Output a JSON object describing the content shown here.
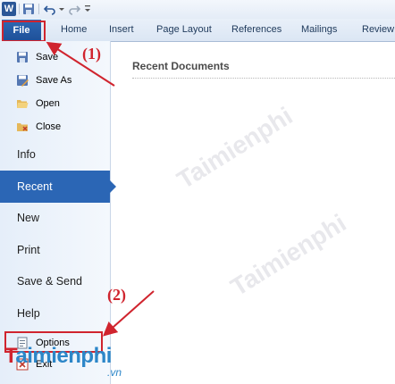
{
  "qat": {
    "app_icon_letter": "W"
  },
  "ribbon": {
    "tabs": [
      "File",
      "Home",
      "Insert",
      "Page Layout",
      "References",
      "Mailings",
      "Review"
    ]
  },
  "backstage": {
    "small_commands": [
      "Save",
      "Save As",
      "Open",
      "Close"
    ],
    "info": "Info",
    "recent": "Recent",
    "new": "New",
    "print": "Print",
    "save_send": "Save & Send",
    "help": "Help",
    "options": "Options",
    "exit": "Exit"
  },
  "main": {
    "title": "Recent Documents"
  },
  "annotations": {
    "step1": "(1)",
    "step2": "(2)",
    "color": "#d0242e"
  },
  "watermark": {
    "brand": "Taimienphi",
    "domain": ".vn",
    "logo_color": "#2c86c8"
  }
}
